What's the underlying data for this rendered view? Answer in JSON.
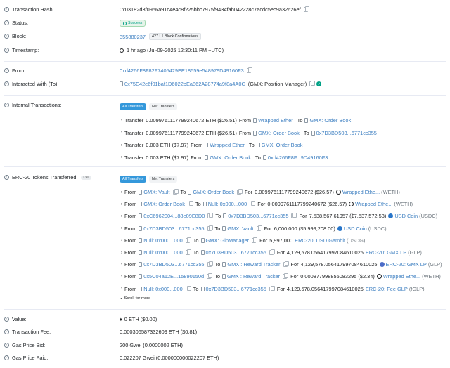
{
  "labels": {
    "tx_hash": "Transaction Hash:",
    "status": "Status:",
    "block": "Block:",
    "timestamp": "Timestamp:",
    "from": "From:",
    "interacted": "Interacted With (To):",
    "internal": "Internal Transactions:",
    "erc20": "ERC-20 Tokens Transferred:",
    "value": "Value:",
    "fee": "Transaction Fee:",
    "gas_bid": "Gas Price Bid:",
    "gas_paid": "Gas Price Paid:"
  },
  "tx_hash": "0x03182d3f0956a91c4e4c8f225bbc7975f9434fab042228c7acdc5ec9a32626ef",
  "status": "Success",
  "block": {
    "number": "355880237",
    "confirmations": "427 L1 Block Confirmations"
  },
  "timestamp": "1 hr ago (Jul-09-2025 12:30:11 PM +UTC)",
  "from": "0xd4266F8F82F7405429EE18559e548979D49160F3",
  "interacted": {
    "address": "0x75E42e6f01baf1D6022bEa862A28774a9f8a4A0C",
    "name": "(GMX: Position Manager)"
  },
  "tabs": {
    "all": "All Transfers",
    "net": "Net Transfers"
  },
  "words": {
    "transfer": "Transfer",
    "from": "From",
    "to": "To",
    "for": "For"
  },
  "internal": [
    {
      "amount": "0.0099761117799240672 ETH ($26.51)",
      "from": "Wrapped Ether",
      "to": "GMX: Order Book"
    },
    {
      "amount": "0.0099761117799240672 ETH ($26.51)",
      "from": "GMX: Order Book",
      "to": "0x7D3BD503...6771cc355"
    },
    {
      "amount": "0.003 ETH ($7.97)",
      "from": "Wrapped Ether",
      "to": "GMX: Order Book"
    },
    {
      "amount": "0.003 ETH ($7.97)",
      "from": "GMX: Order Book",
      "to": "0xd4266F8F...9D49160F3"
    }
  ],
  "erc20_count": "130",
  "erc20": [
    {
      "from": "GMX: Vault",
      "to": "GMX: Order Book",
      "amount": "0.0099761117799240672 ($26.57)",
      "token": "Wrapped Ethe...",
      "sym": "(WETH)",
      "coin": "weth"
    },
    {
      "from": "GMX: Order Book",
      "to": "Null: 0x000...000",
      "amount": "0.0099761117799240672 ($26.57)",
      "token": "Wrapped Ethe...",
      "sym": "(WETH)",
      "coin": "weth"
    },
    {
      "from": "0xC6962004...88e09E8D0",
      "to": "0x7D3BD503...6771cc355",
      "amount": "7,538,567.61957 ($7,537,572.53)",
      "token": "USD Coin",
      "sym": "(USDC)",
      "coin": "usdc"
    },
    {
      "from": "0x7D3BD503...6771cc355",
      "to": "GMX: Vault",
      "amount": "6,000,000 ($5,999,208.00)",
      "token": "USD Coin",
      "sym": "(USDC)",
      "coin": "usdc"
    },
    {
      "from": "Null: 0x000...000",
      "to": "GMX: GlpManager",
      "amount": "5,997,000",
      "token": "ERC-20: USD Gambit",
      "sym": "(USDG)",
      "coin": "none"
    },
    {
      "from": "Null: 0x000...000",
      "to": "0x7D3BD503...6771cc355",
      "amount": "4,129,578.056417997084610025",
      "token": "ERC-20: GMX LP",
      "sym": "(GLP)",
      "coin": "none"
    },
    {
      "from": "0x7D3BD503...6771cc355",
      "to": "GMX : Reward Tracker",
      "amount": "4,129,578.056417997084610025",
      "token": "ERC-20: GMX LP",
      "sym": "(GLP)",
      "coin": "glp"
    },
    {
      "from": "0x5C04a12E...15890150d",
      "to": "GMX : Reward Tracker",
      "amount": "0.000877998855083295 ($2.34)",
      "token": "Wrapped Ethe...",
      "sym": "(WETH)",
      "coin": "weth"
    },
    {
      "from": "Null: 0x000...000",
      "to": "0x7D3BD503...6771cc355",
      "amount": "4,129,578.056417997084610025",
      "token": "ERC-20: Fee GLP",
      "sym": "(fGLP)",
      "coin": "none"
    }
  ],
  "scroll_more": "Scroll for more",
  "value": "0 ETH ($0.00)",
  "fee": "0.000306587332609 ETH ($0.81)",
  "gas_bid": "200 Gwei (0.0000002 ETH)",
  "gas_paid": "0.022207 Gwei (0.000000000022207 ETH)"
}
